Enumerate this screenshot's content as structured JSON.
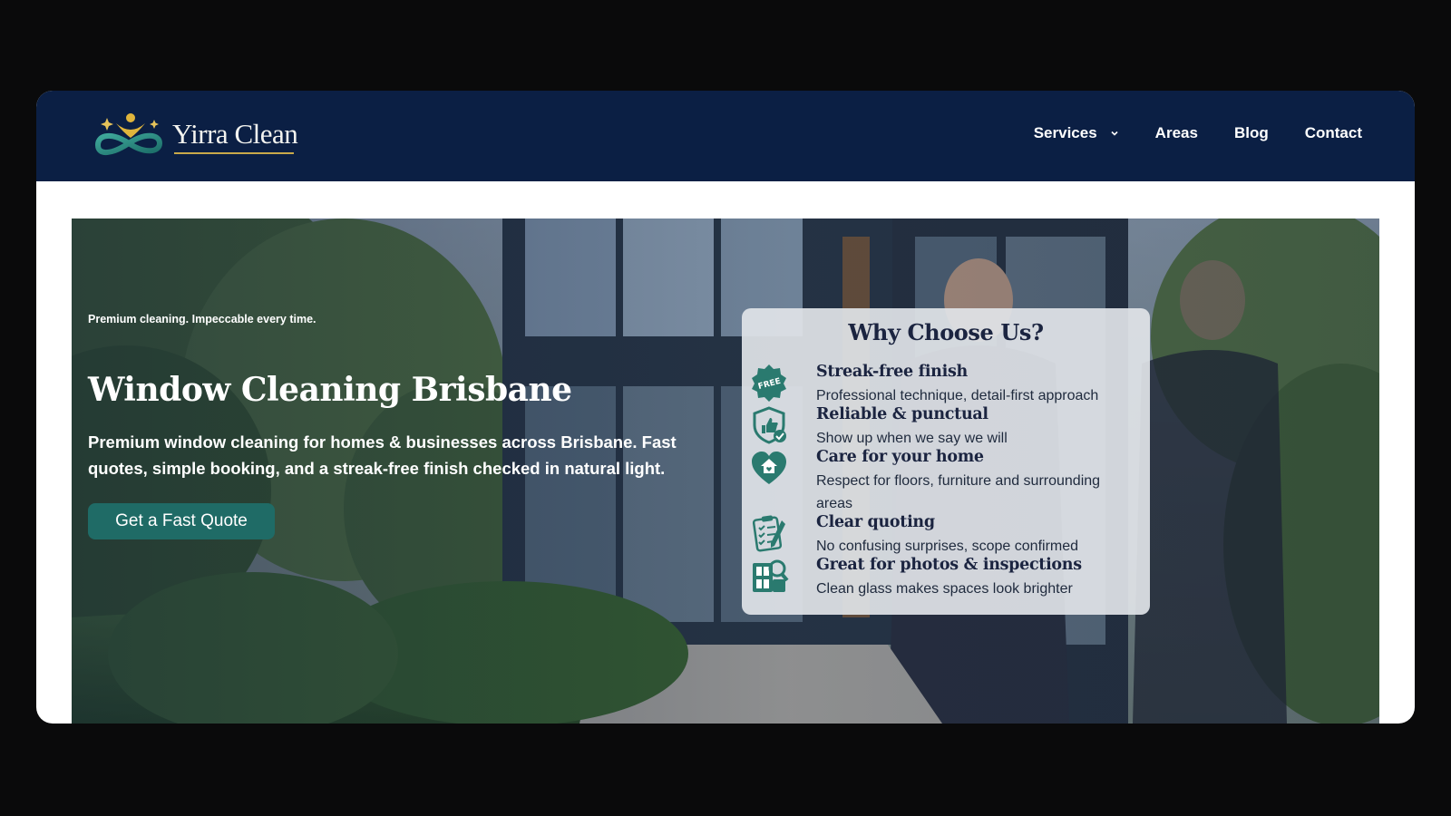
{
  "brand": {
    "name": "Yirra Clean"
  },
  "nav": {
    "items": [
      {
        "label": "Services",
        "has_dropdown": true
      },
      {
        "label": "Areas"
      },
      {
        "label": "Blog"
      },
      {
        "label": "Contact"
      }
    ]
  },
  "hero": {
    "tagline": "Premium cleaning. Impeccable every time.",
    "title": "Window Cleaning Brisbane",
    "subtitle": "Premium window cleaning for homes & businesses across Brisbane. Fast quotes, simple booking, and a streak-free finish checked in natural light.",
    "cta_label": "Get a Fast Quote"
  },
  "why_choose": {
    "title": "Why Choose Us?",
    "features": [
      {
        "icon": "free-badge-icon",
        "title": "Streak-free finish",
        "desc": "Professional technique, detail-first approach"
      },
      {
        "icon": "shield-thumbs-up-icon",
        "title": "Reliable & punctual",
        "desc": "Show up when we say we will"
      },
      {
        "icon": "heart-home-icon",
        "title": "Care for your home",
        "desc": "Respect for floors, furniture and surrounding areas"
      },
      {
        "icon": "clipboard-checklist-icon",
        "title": "Clear quoting",
        "desc": "No confusing surprises, scope confirmed"
      },
      {
        "icon": "inspection-magnifier-icon",
        "title": "Great for photos & inspections",
        "desc": "Clean glass makes spaces look brighter"
      }
    ]
  },
  "colors": {
    "navbar": "#0b1f44",
    "accent_teal": "#1f6b66",
    "icon_teal": "#2a7a6f",
    "gold": "#c9a94a"
  }
}
